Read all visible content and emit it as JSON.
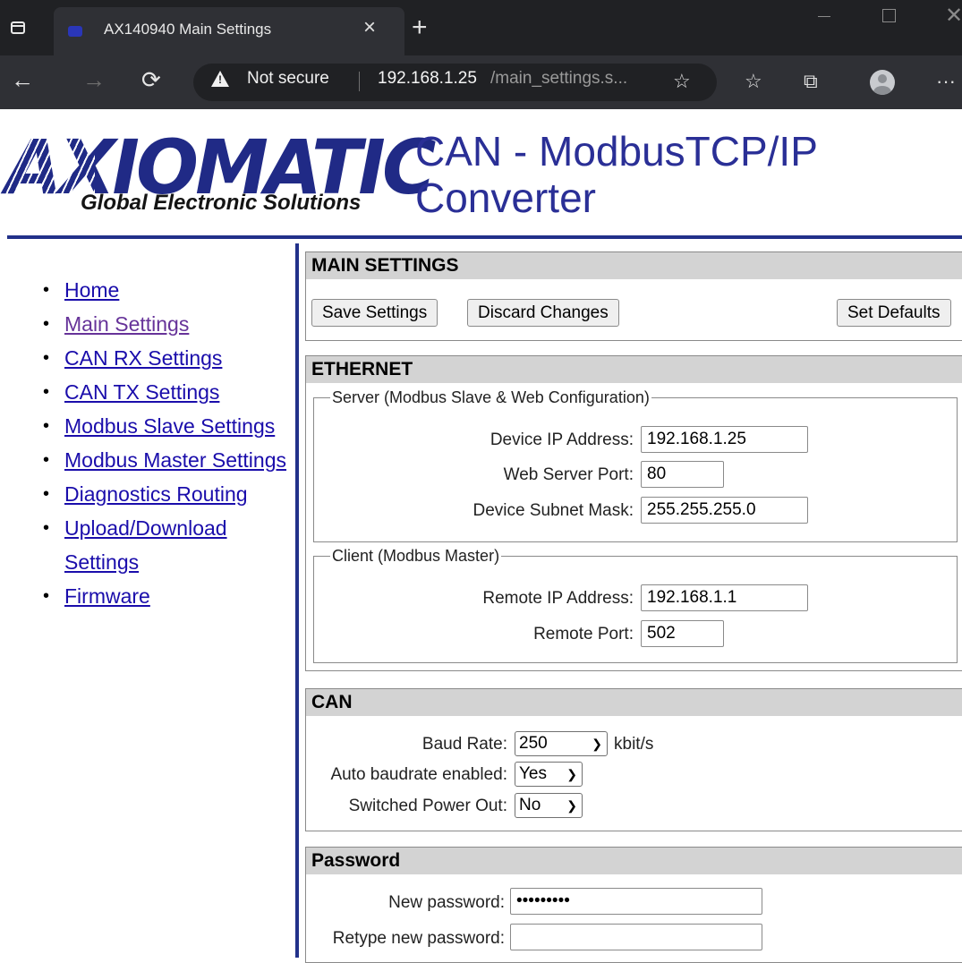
{
  "browser": {
    "tab_title": "AX140940 Main Settings",
    "tab_close": "×",
    "new_tab": "+",
    "security_label": "Not secure",
    "url_host": "192.168.1.25",
    "url_path": "/main_settings.s...",
    "back": "←",
    "forward": "→",
    "reload": "⟳",
    "menu": "···"
  },
  "header": {
    "logo_text": "AXIOMATIC",
    "logo_tagline": "Global Electronic Solutions",
    "title": "CAN - ModbusTCP/IP Converter"
  },
  "nav": {
    "items": [
      {
        "label": "Home",
        "visited": false
      },
      {
        "label": "Main Settings",
        "visited": true
      },
      {
        "label": "CAN RX Settings",
        "visited": false
      },
      {
        "label": "CAN TX Settings",
        "visited": false
      },
      {
        "label": "Modbus Slave Settings",
        "visited": false
      },
      {
        "label": "Modbus Master Settings",
        "visited": false
      },
      {
        "label": "Diagnostics Routing",
        "visited": false
      },
      {
        "label": "Upload/Download Settings",
        "visited": false
      },
      {
        "label": "Firmware",
        "visited": false
      }
    ]
  },
  "main_settings": {
    "heading": "MAIN SETTINGS",
    "save_label": "Save Settings",
    "discard_label": "Discard Changes",
    "defaults_label": "Set Defaults"
  },
  "ethernet": {
    "heading": "ETHERNET",
    "server": {
      "legend": "Server (Modbus Slave & Web Configuration)",
      "ip_label": "Device IP Address:",
      "ip_value": "192.168.1.25",
      "port_label": "Web Server Port:",
      "port_value": "80",
      "mask_label": "Device Subnet Mask:",
      "mask_value": "255.255.255.0"
    },
    "client": {
      "legend": "Client (Modbus Master)",
      "ip_label": "Remote IP Address:",
      "ip_value": "192.168.1.1",
      "port_label": "Remote Port:",
      "port_value": "502"
    }
  },
  "can": {
    "heading": "CAN",
    "baud_label": "Baud Rate:",
    "baud_value": "250",
    "baud_unit": "kbit/s",
    "auto_label": "Auto baudrate enabled:",
    "auto_value": "Yes",
    "power_label": "Switched Power Out:",
    "power_value": "No"
  },
  "password": {
    "heading": "Password",
    "new_label": "New password:",
    "new_value": "•••••••••",
    "retype_label": "Retype new password:",
    "retype_value": ""
  }
}
